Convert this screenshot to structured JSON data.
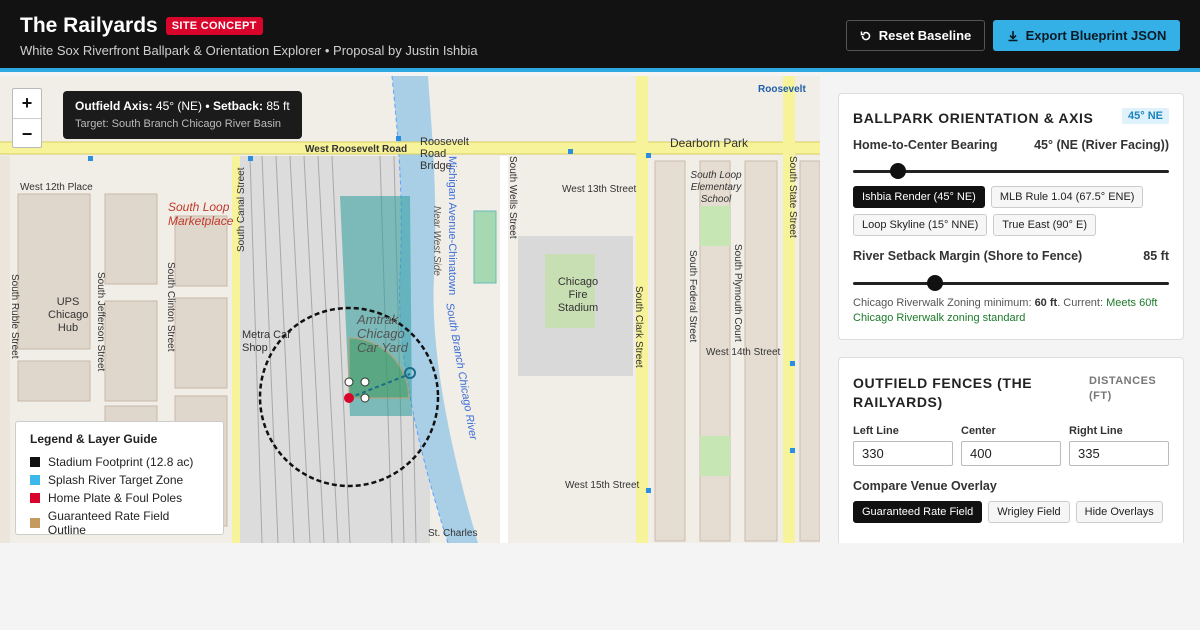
{
  "header": {
    "title": "The Railyards",
    "badge": "SITE CONCEPT",
    "subtitle": "White Sox Riverfront Ballpark & Orientation Explorer • Proposal by Justin Ishbia",
    "reset_label": "Reset Baseline",
    "export_label": "Export Blueprint JSON"
  },
  "map": {
    "zoom_in": "+",
    "zoom_out": "−",
    "tooltip": {
      "axis_label": "Outfield Axis:",
      "axis_value": "45° (NE)",
      "sep": "•",
      "setback_label": "Setback:",
      "setback_value": "85 ft",
      "target": "Target: South Branch Chicago River Basin"
    },
    "labels": {
      "roosevelt_road": "West Roosevelt Road",
      "roosevelt_bridge": "Roosevelt Road Bridge",
      "roosevelt_right": "Roosevelt",
      "dearborn": "Dearborn Park",
      "w12": "West 12th Place",
      "w13": "West 13th Street",
      "w14": "West 14th Street",
      "w15": "West 15th Street",
      "south_loop_marketplace": "South Loop Marketplace",
      "ups": "UPS Chicago Hub",
      "metra": "Metra Car Shop",
      "amtrak": "Amtrak Chicago Car Yard",
      "fire_stadium": "Chicago Fire Stadium",
      "south_loop_school": "South Loop Elementary School",
      "st_charles": "St. Charles",
      "canal": "South Canal Street",
      "clark": "South Clark Street",
      "state": "South State Street",
      "wells": "South Wells Street",
      "federal": "South Federal Street",
      "plymouth": "South Plymouth Court",
      "jefferson": "South Jefferson Street",
      "clinton": "South Clinton Street",
      "ruble": "South Ruble Street",
      "river": "South Branch Chicago River",
      "michigan_chinatown": "Michigan Avenue-Chinatown",
      "near_west_side": "Near West Side"
    },
    "legend": {
      "title": "Legend & Layer Guide",
      "items": [
        {
          "label": "Stadium Footprint (12.8 ac)",
          "color": "#111111"
        },
        {
          "label": "Splash River Target Zone",
          "color": "#3db8ea"
        },
        {
          "label": "Home Plate & Foul Poles",
          "color": "#d9042b"
        },
        {
          "label": "Guaranteed Rate Field Outline",
          "color": "#c49a5e"
        }
      ]
    }
  },
  "orientation": {
    "title": "BALLPARK ORIENTATION & AXIS",
    "badge": "45° NE",
    "bearing_label": "Home-to-Center Bearing",
    "bearing_value": "45° (NE (River Facing))",
    "bearing_level": 0.143,
    "presets": [
      {
        "label": "Ishbia Render (45° NE)",
        "active": true
      },
      {
        "label": "MLB Rule 1.04 (67.5° ENE)",
        "active": false
      },
      {
        "label": "Loop Skyline (15° NNE)",
        "active": false
      },
      {
        "label": "True East (90° E)",
        "active": false
      }
    ],
    "setback_label": "River Setback Margin (Shore to Fence)",
    "setback_value": "85 ft",
    "setback_level": 0.26,
    "note_prefix": "Chicago Riverwalk Zoning minimum: ",
    "note_min": "60 ft",
    "note_mid": ". Current: ",
    "note_status": "Meets 60ft Chicago Riverwalk zoning standard"
  },
  "fences": {
    "title": "OUTFIELD FENCES (THE RAILYARDS)",
    "units": "DISTANCES (FT)",
    "left_label": "Left Line",
    "left_value": "330",
    "center_label": "Center",
    "center_value": "400",
    "right_label": "Right Line",
    "right_value": "335",
    "compare_label": "Compare Venue Overlay",
    "overlays": [
      {
        "label": "Guaranteed Rate Field",
        "active": true
      },
      {
        "label": "Wrigley Field",
        "active": false
      },
      {
        "label": "Hide Overlays",
        "active": false
      }
    ]
  }
}
